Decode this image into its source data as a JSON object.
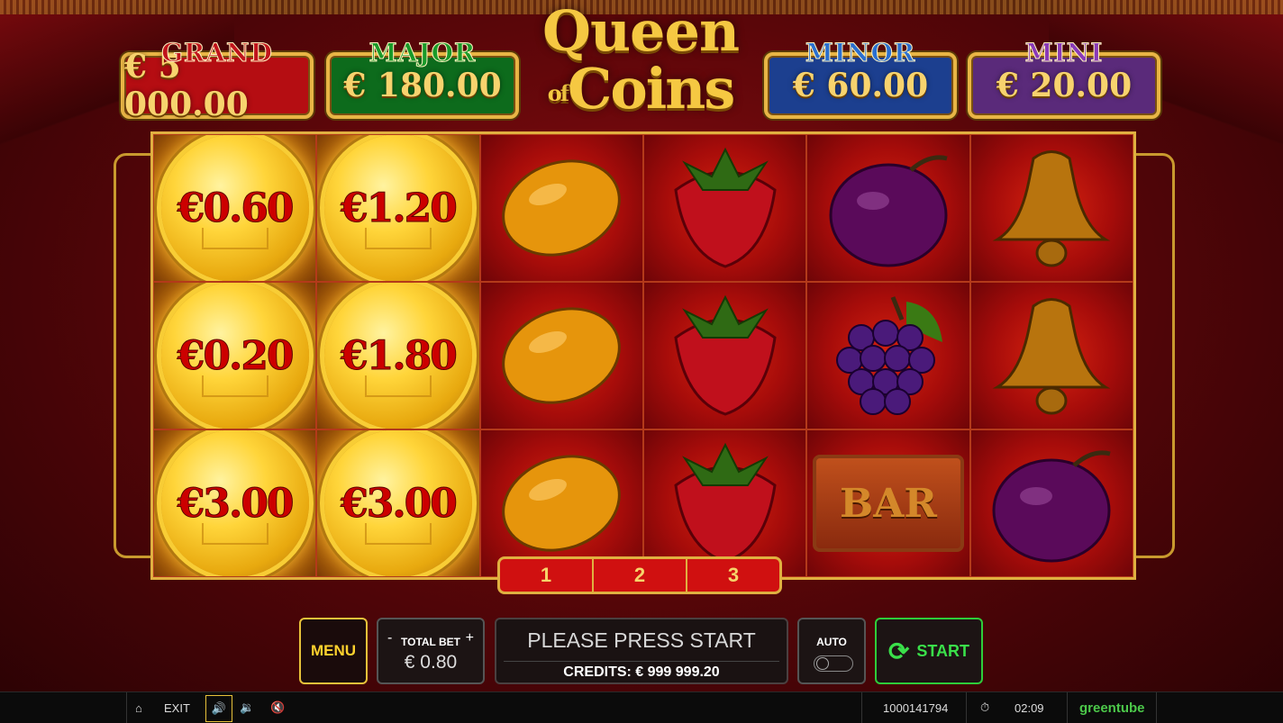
{
  "jackpots": [
    {
      "label": "GRAND",
      "value": "€ 5 000.00",
      "label_color": "#c0141c",
      "bg": "#b50d12"
    },
    {
      "label": "MAJOR",
      "value": "€ 180.00",
      "label_color": "#1a9a2a",
      "bg": "#0d6b1c"
    },
    {
      "label": "MINOR",
      "value": "€ 60.00",
      "label_color": "#2a6fd0",
      "bg": "#1c3f8f"
    },
    {
      "label": "MINI",
      "value": "€ 20.00",
      "label_color": "#8a3ab8",
      "bg": "#5a2a7a"
    }
  ],
  "logo": {
    "line1": "Queen",
    "line2_of": "of",
    "line2": "Coins"
  },
  "reels": {
    "coins": [
      "€0.60",
      "€1.20",
      "€0.20",
      "€1.80",
      "€3.00",
      "€3.00"
    ],
    "symbols": [
      "lemon-icon",
      "strawberry-icon",
      "plum-icon",
      "bell-icon",
      "lemon-icon",
      "strawberry-icon",
      "grapes-icon",
      "bell-icon",
      "lemon-icon",
      "strawberry-icon",
      "bar-icon",
      "plum-icon"
    ],
    "bar_text": "BAR"
  },
  "paylines": [
    "1",
    "2",
    "3"
  ],
  "controls": {
    "menu_label": "MENU",
    "bet_minus": "-",
    "bet_plus": "+",
    "total_bet_label": "TOTAL BET",
    "total_bet_value": "€ 0.80",
    "message": "PLEASE PRESS START",
    "credits": "CREDITS: € 999 999.20",
    "auto_label": "AUTO",
    "start_label": "START"
  },
  "statusbar": {
    "exit_label": "EXIT",
    "session_id": "1000141794",
    "time": "02:09",
    "brand": "greentube"
  },
  "colors": {
    "gold": "#e0b040",
    "start_green": "#2ecc3a",
    "menu_yellow": "#ffd22e"
  }
}
